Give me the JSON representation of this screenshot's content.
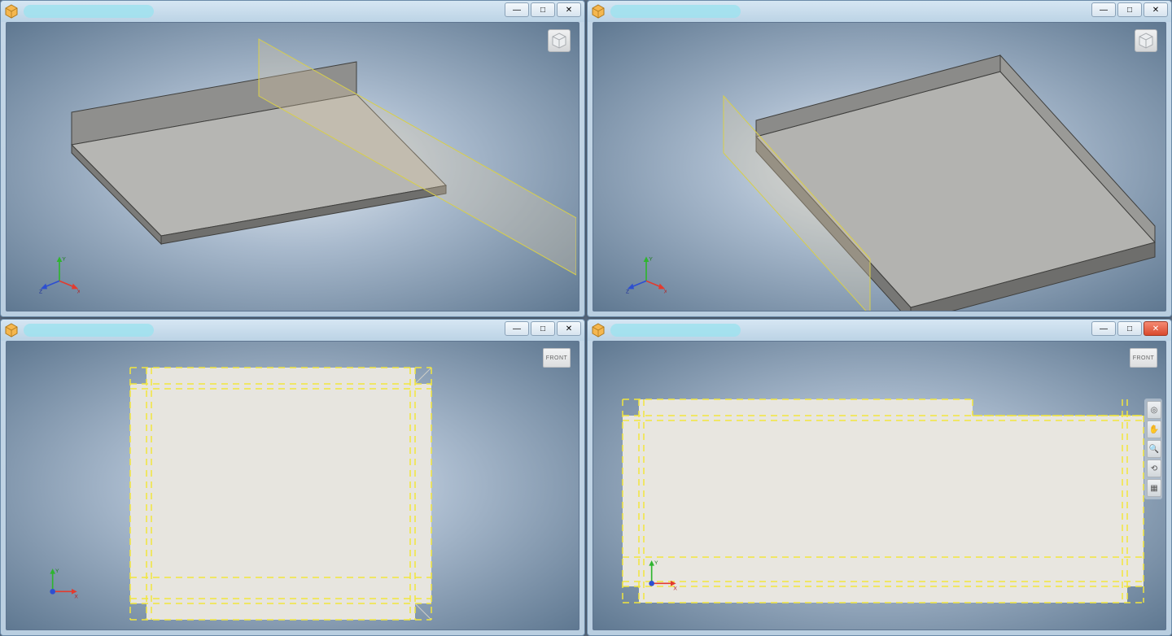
{
  "windows": [
    {
      "id": "tl",
      "title": "",
      "view": "iso",
      "viewcube": "ISO",
      "close_style": "normal",
      "controls": {
        "min": "—",
        "max": "□",
        "close": "✕"
      }
    },
    {
      "id": "tr",
      "title": "",
      "view": "iso",
      "viewcube": "ISO",
      "close_style": "normal",
      "controls": {
        "min": "—",
        "max": "□",
        "close": "✕"
      }
    },
    {
      "id": "bl",
      "title": "",
      "view": "front",
      "viewcube": "FRONT",
      "close_style": "normal",
      "controls": {
        "min": "—",
        "max": "□",
        "close": "✕"
      }
    },
    {
      "id": "br",
      "title": "",
      "view": "front",
      "viewcube": "FRONT",
      "close_style": "red",
      "controls": {
        "min": "—",
        "max": "□",
        "close": "✕"
      }
    }
  ],
  "axes": {
    "x": "X",
    "y": "Y",
    "z": "Z"
  },
  "viewcube_labels": {
    "iso": "",
    "front": "FRONT"
  },
  "nav_tools": [
    {
      "name": "full-nav-wheel",
      "glyph": "◎"
    },
    {
      "name": "pan",
      "glyph": "✋"
    },
    {
      "name": "zoom",
      "glyph": "🔍"
    },
    {
      "name": "orbit",
      "glyph": "⟲"
    },
    {
      "name": "look-at",
      "glyph": "▦"
    }
  ],
  "colors": {
    "bend_line": "#f2e63c",
    "sheet_face": "#e6e4de",
    "metal": "#9a9a98",
    "plane_fill": "rgba(222,201,165,0.35)",
    "axis_x": "#e33b2e",
    "axis_y": "#2fb52f",
    "axis_z": "#2d4fd1"
  }
}
